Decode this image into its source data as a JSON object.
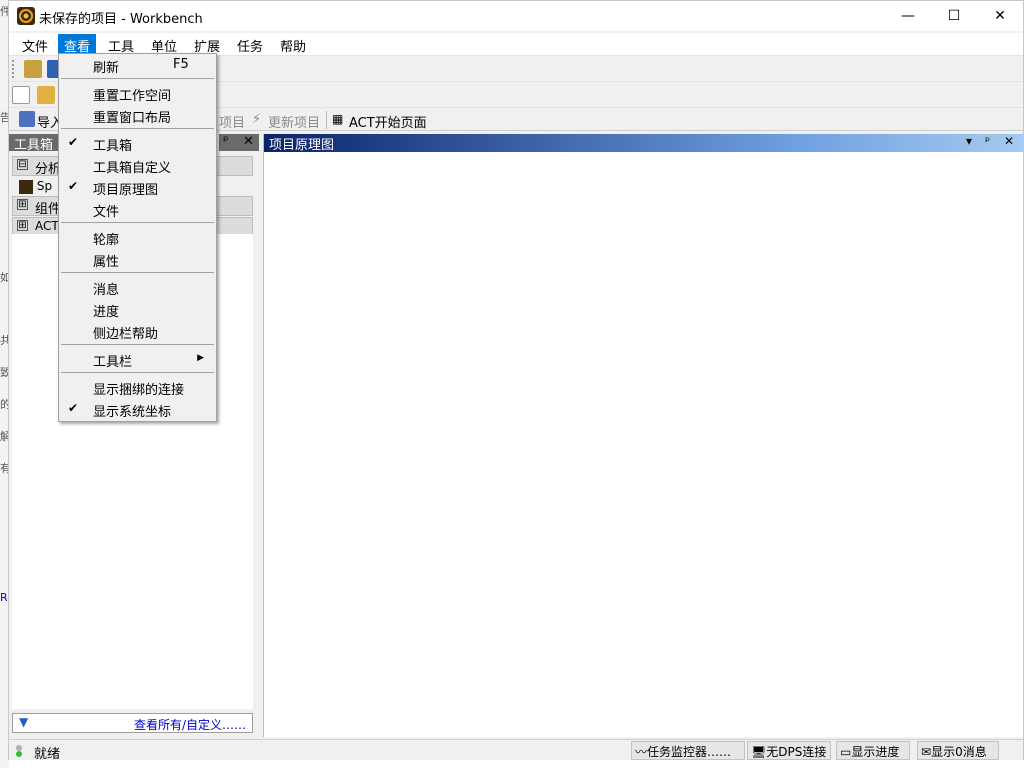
{
  "background_fragments": [
    "件",
    "告",
    "如",
    "共",
    "致",
    "的",
    "解",
    "有",
    "R"
  ],
  "window": {
    "title": "未保存的项目 - Workbench",
    "controls": {
      "minimize": "—",
      "maximize": "☐",
      "close": "✕"
    }
  },
  "menubar": {
    "items": [
      "文件",
      "查看",
      "工具",
      "单位",
      "扩展",
      "任务",
      "帮助"
    ],
    "active": "查看"
  },
  "toolbar3": {
    "import_label": "导入",
    "project_label": "项目",
    "update_label": "更新项目",
    "act_start_label": "ACT开始页面"
  },
  "toolbox": {
    "title": "工具箱",
    "pin": "ᵖ",
    "close": "✕",
    "groups": [
      {
        "sign": "⊟",
        "label": "分析"
      },
      {
        "sign": "⊞",
        "label": "组件"
      },
      {
        "sign": "⊞",
        "label": "ACT"
      }
    ],
    "item_label": "Sp",
    "filter_link": "查看所有/自定义……"
  },
  "schematic": {
    "title": "项目原理图",
    "ctl_dropdown": "▾",
    "ctl_pin": "ᵖ",
    "ctl_close": "✕"
  },
  "view_menu": {
    "refresh": {
      "label": "刷新",
      "shortcut": "F5"
    },
    "reset_workspace": "重置工作空间",
    "reset_layout": "重置窗口布局",
    "toolbox": {
      "label": "工具箱",
      "checked": true
    },
    "toolbox_custom": "工具箱自定义",
    "project_schematic": {
      "label": "项目原理图",
      "checked": true
    },
    "files": "文件",
    "outline": "轮廓",
    "properties": "属性",
    "messages": "消息",
    "progress": "进度",
    "sidebar_help": "侧边栏帮助",
    "toolbars": "工具栏",
    "show_connections": "显示捆绑的连接",
    "show_coords": {
      "label": "显示系统坐标",
      "checked": true
    },
    "check_glyph": "✔",
    "submenu_arrow": "▶"
  },
  "statusbar": {
    "status": "就绪",
    "task_monitor": "任务监控器……",
    "dps": "无DPS连接",
    "show_progress": "显示进度",
    "messages": "显示0消息"
  }
}
